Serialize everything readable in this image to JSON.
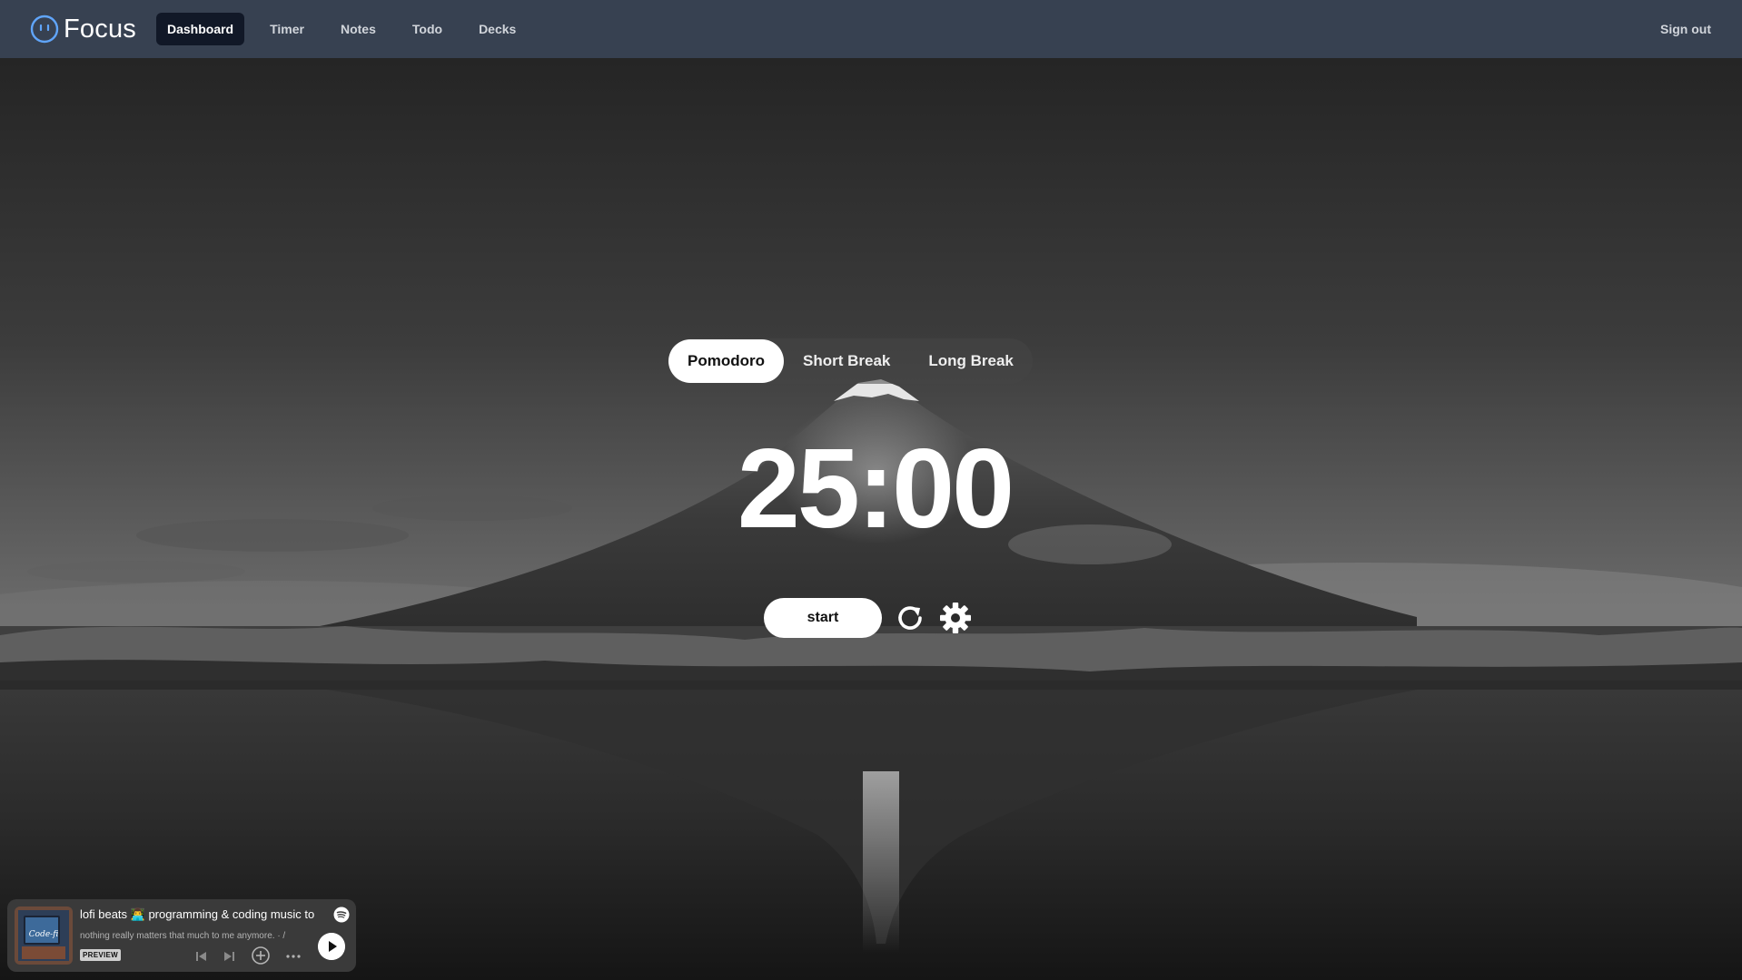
{
  "app": {
    "brand_name": "Focus",
    "colors": {
      "nav_bg": "#374151",
      "nav_active_bg": "#111827",
      "brand_icon": "#60a5fa",
      "timer_text": "#ffffff"
    }
  },
  "nav": {
    "items": [
      {
        "label": "Dashboard",
        "active": true
      },
      {
        "label": "Timer",
        "active": false
      },
      {
        "label": "Notes",
        "active": false
      },
      {
        "label": "Todo",
        "active": false
      },
      {
        "label": "Decks",
        "active": false
      }
    ],
    "sign_out_label": "Sign out"
  },
  "timer": {
    "modes": [
      {
        "label": "Pomodoro",
        "active": true
      },
      {
        "label": "Short Break",
        "active": false
      },
      {
        "label": "Long Break",
        "active": false
      }
    ],
    "display": "25:00",
    "start_label": "start",
    "reset_icon": "reset-icon",
    "settings_icon": "gear-icon"
  },
  "player": {
    "track_title": "lofi beats 👨‍💻 programming & coding music to",
    "track_subtitle": "nothing really matters that much to me anymore. · /",
    "preview_label": "PREVIEW",
    "album_art_text": "Code-fi",
    "icons": [
      "spotify-icon",
      "skip-back-icon",
      "skip-forward-icon",
      "add-icon",
      "more-icon",
      "play-icon"
    ]
  }
}
